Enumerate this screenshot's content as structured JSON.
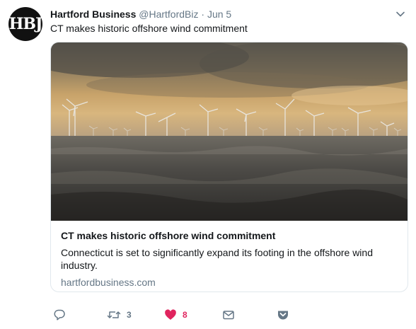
{
  "tweet": {
    "avatar_text": "HBJ",
    "author_name": "Hartford Business",
    "handle": "@HartfordBiz",
    "separator": "·",
    "date": "Jun 5",
    "text": "CT makes historic offshore wind commitment"
  },
  "card": {
    "title": "CT makes historic offshore wind commitment",
    "description": "Connecticut is set to significantly expand its footing in the offshore wind industry.",
    "domain": "hartfordbusiness.com"
  },
  "actions": {
    "reply_icon": "reply-icon",
    "retweet_icon": "retweet-icon",
    "retweet_count": "3",
    "like_icon": "heart-icon",
    "like_count": "8",
    "dm_icon": "envelope-icon",
    "pocket_icon": "pocket-icon"
  },
  "colors": {
    "text": "#14171a",
    "muted": "#657786",
    "like": "#e0245e",
    "border": "#e1e8ed"
  }
}
